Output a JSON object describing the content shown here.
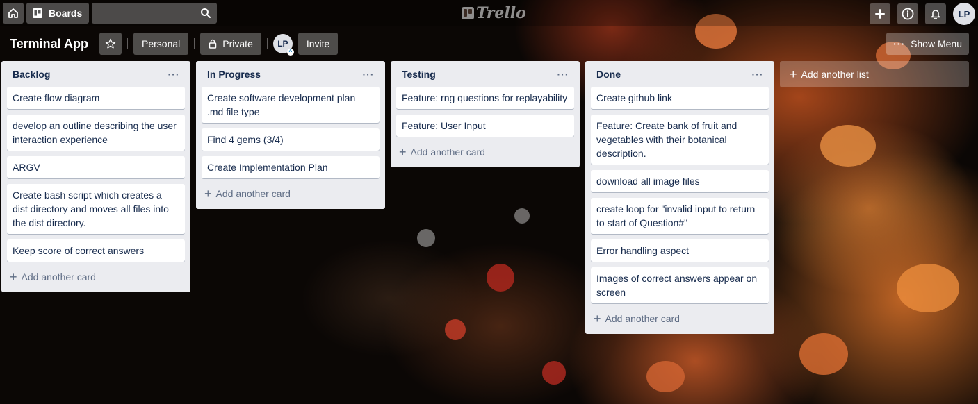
{
  "header": {
    "boards_label": "Boards",
    "logo_text": "Trello",
    "avatar_initials": "LP"
  },
  "board": {
    "title": "Terminal App",
    "visibility_team": "Personal",
    "visibility_private": "Private",
    "member_initials": "LP",
    "invite_label": "Invite",
    "show_menu_label": "Show Menu"
  },
  "lists": [
    {
      "title": "Backlog",
      "cards": [
        "Create flow diagram",
        "develop an outline describing the user interaction experience",
        "ARGV",
        "Create bash script which creates a dist directory and moves all files into the dist directory.",
        "Keep score of correct answers"
      ],
      "add_card_label": "Add another card"
    },
    {
      "title": "In Progress",
      "cards": [
        "Create software development plan .md file type",
        "Find 4 gems (3/4)",
        "Create Implementation Plan"
      ],
      "add_card_label": "Add another card"
    },
    {
      "title": "Testing",
      "cards": [
        "Feature: rng questions for replayability",
        "Feature: User Input"
      ],
      "add_card_label": "Add another card"
    },
    {
      "title": "Done",
      "cards": [
        "Create github link",
        "Feature: Create bank of fruit and vegetables with their botanical description.",
        "download all image files",
        "create loop for \"invalid input to return to start of Question#\"",
        "Error handling aspect",
        "Images of correct answers appear on screen"
      ],
      "add_card_label": "Add another card"
    }
  ],
  "add_list_label": "Add another list"
}
